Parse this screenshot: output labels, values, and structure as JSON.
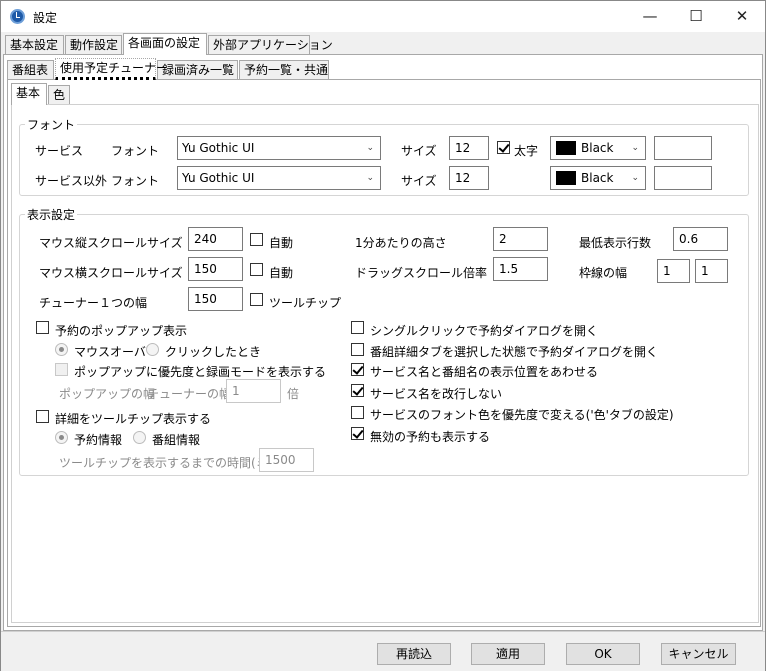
{
  "window": {
    "title": "設定",
    "minimize": "—",
    "maximize": "☐",
    "close": "✕"
  },
  "main_tabs": [
    "基本設定",
    "動作設定",
    "各画面の設定",
    "外部アプリケーション"
  ],
  "sub_tabs": [
    "番組表",
    "使用予定チューナー",
    "録画済み一覧",
    "予約一覧・共通"
  ],
  "inner_tabs": [
    "基本",
    "色"
  ],
  "font_group": {
    "title": "フォント",
    "service_label": "サービス",
    "font_label": "フォント",
    "service_font": "Yu Gothic UI",
    "size_label": "サイズ",
    "service_size": "12",
    "bold_label": "太字",
    "bold_checked": true,
    "service_color": "Black",
    "other_label": "サービス以外",
    "other_font": "Yu Gothic UI",
    "other_size": "12",
    "other_color": "Black"
  },
  "display_group": {
    "title": "表示設定",
    "vscroll_label": "マウス縦スクロールサイズ",
    "vscroll_value": "240",
    "hscroll_label": "マウス横スクロールサイズ",
    "hscroll_value": "150",
    "auto_label": "自動",
    "tuner_width_label": "チューナー１つの幅",
    "tuner_width_value": "150",
    "tooltip_label": "ツールチップ",
    "height_per_min_label": "1分あたりの高さ",
    "height_per_min_value": "2",
    "drag_scroll_label": "ドラッグスクロール倍率",
    "drag_scroll_value": "1.5",
    "min_rows_label": "最低表示行数",
    "min_rows_value": "0.6",
    "border_width_label": "枠線の幅",
    "border_width_1": "1",
    "border_width_2": "1",
    "popup_label": "予約のポップアップ表示",
    "mouseover_label": "マウスオーバー",
    "click_label": "クリックしたとき",
    "popup_priority_label": "ポップアップに優先度と録画モードを表示する",
    "popup_width_label": "ポップアップの幅",
    "tuner_width_x_label": "チューナーの幅 ×",
    "popup_width_value": "1",
    "times_label": "倍",
    "detail_tooltip_label": "詳細をツールチップ表示する",
    "reserve_info_label": "予約情報",
    "program_info_label": "番組情報",
    "tooltip_delay_label": "ツールチップを表示するまでの時間(ミリ秒)",
    "tooltip_delay_value": "1500",
    "right_options": [
      {
        "label": "シングルクリックで予約ダイアログを開く",
        "checked": false
      },
      {
        "label": "番組詳細タブを選択した状態で予約ダイアログを開く",
        "checked": false
      },
      {
        "label": "サービス名と番組名の表示位置をあわせる",
        "checked": true
      },
      {
        "label": "サービス名を改行しない",
        "checked": true
      },
      {
        "label": "サービスのフォント色を優先度で変える('色'タブの設定)",
        "checked": false
      },
      {
        "label": "無効の予約も表示する",
        "checked": true
      }
    ]
  },
  "footer": {
    "reload": "再読込",
    "apply": "適用",
    "ok": "OK",
    "cancel": "キャンセル"
  }
}
